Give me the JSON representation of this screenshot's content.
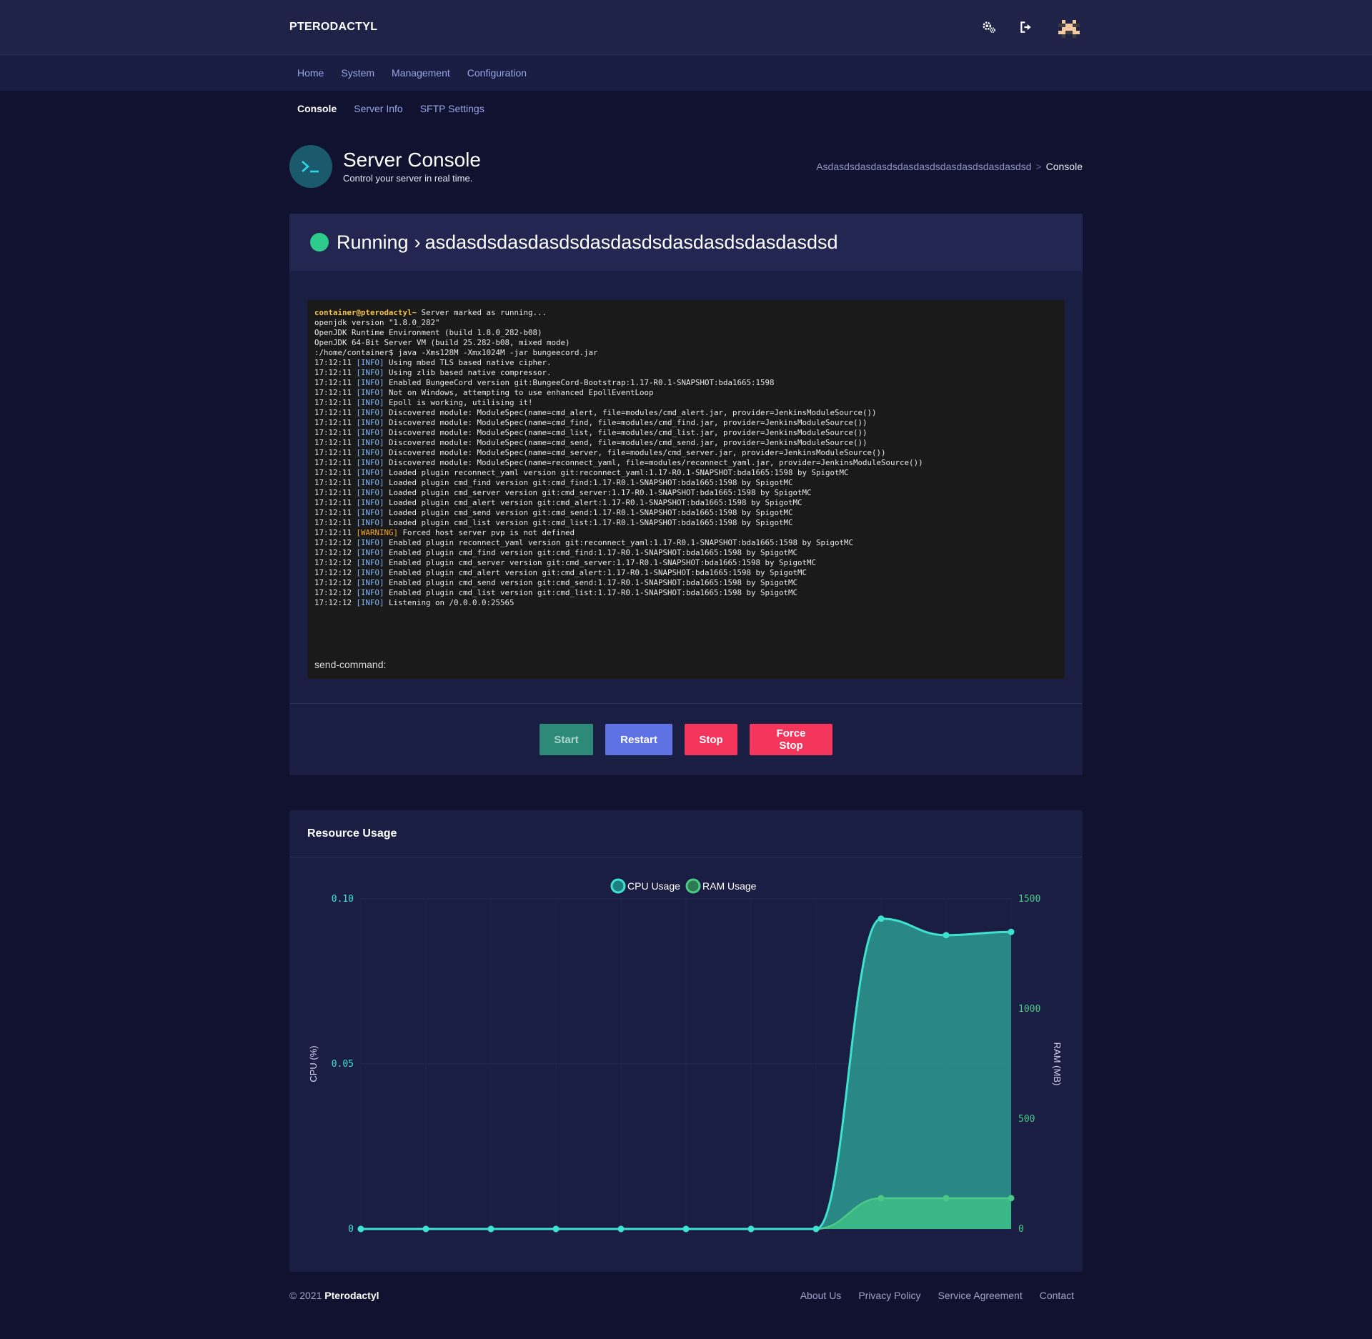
{
  "brand": "PTERODACTYL",
  "top_icons": [
    "settings-icon",
    "logout-icon",
    "avatar"
  ],
  "nav": [
    "Home",
    "System",
    "Management",
    "Configuration"
  ],
  "subnav": [
    "Console",
    "Server Info",
    "SFTP Settings"
  ],
  "header": {
    "title": "Server Console",
    "subtitle": "Control your server in real time.",
    "breadcrumb_parent": "Asdasdsdasdasdsdasdasdsdasdasdsdasdasdsd",
    "breadcrumb_sep": ">",
    "breadcrumb_current": "Console"
  },
  "server": {
    "status": "Running",
    "arrow": "›",
    "name": "asdasdsdasdasdsdasdasdsdasdasdsdasdasdsd"
  },
  "console": {
    "lines": [
      {
        "prompt": "container@pterodactyl~",
        "text": " Server marked as running..."
      },
      {
        "text": "openjdk version \"1.8.0_282\""
      },
      {
        "text": "OpenJDK Runtime Environment (build 1.8.0_282-b08)"
      },
      {
        "text": "OpenJDK 64-Bit Server VM (build 25.282-b08, mixed mode)"
      },
      {
        "text": ":/home/container$ java -Xms128M -Xmx1024M -jar bungeecord.jar"
      },
      {
        "time": "17:12:11",
        "level": "INFO",
        "text": " Using mbed TLS based native cipher."
      },
      {
        "time": "17:12:11",
        "level": "INFO",
        "text": " Using zlib based native compressor."
      },
      {
        "time": "17:12:11",
        "level": "INFO",
        "text": " Enabled BungeeCord version git:BungeeCord-Bootstrap:1.17-R0.1-SNAPSHOT:bda1665:1598"
      },
      {
        "time": "17:12:11",
        "level": "INFO",
        "text": " Not on Windows, attempting to use enhanced EpollEventLoop"
      },
      {
        "time": "17:12:11",
        "level": "INFO",
        "text": " Epoll is working, utilising it!"
      },
      {
        "time": "17:12:11",
        "level": "INFO",
        "text": " Discovered module: ModuleSpec(name=cmd_alert, file=modules/cmd_alert.jar, provider=JenkinsModuleSource())"
      },
      {
        "time": "17:12:11",
        "level": "INFO",
        "text": " Discovered module: ModuleSpec(name=cmd_find, file=modules/cmd_find.jar, provider=JenkinsModuleSource())"
      },
      {
        "time": "17:12:11",
        "level": "INFO",
        "text": " Discovered module: ModuleSpec(name=cmd_list, file=modules/cmd_list.jar, provider=JenkinsModuleSource())"
      },
      {
        "time": "17:12:11",
        "level": "INFO",
        "text": " Discovered module: ModuleSpec(name=cmd_send, file=modules/cmd_send.jar, provider=JenkinsModuleSource())"
      },
      {
        "time": "17:12:11",
        "level": "INFO",
        "text": " Discovered module: ModuleSpec(name=cmd_server, file=modules/cmd_server.jar, provider=JenkinsModuleSource())"
      },
      {
        "time": "17:12:11",
        "level": "INFO",
        "text": " Discovered module: ModuleSpec(name=reconnect_yaml, file=modules/reconnect_yaml.jar, provider=JenkinsModuleSource())"
      },
      {
        "time": "17:12:11",
        "level": "INFO",
        "text": " Loaded plugin reconnect_yaml version git:reconnect_yaml:1.17-R0.1-SNAPSHOT:bda1665:1598 by SpigotMC"
      },
      {
        "time": "17:12:11",
        "level": "INFO",
        "text": " Loaded plugin cmd_find version git:cmd_find:1.17-R0.1-SNAPSHOT:bda1665:1598 by SpigotMC"
      },
      {
        "time": "17:12:11",
        "level": "INFO",
        "text": " Loaded plugin cmd_server version git:cmd_server:1.17-R0.1-SNAPSHOT:bda1665:1598 by SpigotMC"
      },
      {
        "time": "17:12:11",
        "level": "INFO",
        "text": " Loaded plugin cmd_alert version git:cmd_alert:1.17-R0.1-SNAPSHOT:bda1665:1598 by SpigotMC"
      },
      {
        "time": "17:12:11",
        "level": "INFO",
        "text": " Loaded plugin cmd_send version git:cmd_send:1.17-R0.1-SNAPSHOT:bda1665:1598 by SpigotMC"
      },
      {
        "time": "17:12:11",
        "level": "INFO",
        "text": " Loaded plugin cmd_list version git:cmd_list:1.17-R0.1-SNAPSHOT:bda1665:1598 by SpigotMC"
      },
      {
        "time": "17:12:11",
        "level": "WARNING",
        "text": " Forced host server pvp is not defined"
      },
      {
        "time": "17:12:12",
        "level": "INFO",
        "text": " Enabled plugin reconnect_yaml version git:reconnect_yaml:1.17-R0.1-SNAPSHOT:bda1665:1598 by SpigotMC"
      },
      {
        "time": "17:12:12",
        "level": "INFO",
        "text": " Enabled plugin cmd_find version git:cmd_find:1.17-R0.1-SNAPSHOT:bda1665:1598 by SpigotMC"
      },
      {
        "time": "17:12:12",
        "level": "INFO",
        "text": " Enabled plugin cmd_server version git:cmd_server:1.17-R0.1-SNAPSHOT:bda1665:1598 by SpigotMC"
      },
      {
        "time": "17:12:12",
        "level": "INFO",
        "text": " Enabled plugin cmd_alert version git:cmd_alert:1.17-R0.1-SNAPSHOT:bda1665:1598 by SpigotMC"
      },
      {
        "time": "17:12:12",
        "level": "INFO",
        "text": " Enabled plugin cmd_send version git:cmd_send:1.17-R0.1-SNAPSHOT:bda1665:1598 by SpigotMC"
      },
      {
        "time": "17:12:12",
        "level": "INFO",
        "text": " Enabled plugin cmd_list version git:cmd_list:1.17-R0.1-SNAPSHOT:bda1665:1598 by SpigotMC"
      },
      {
        "time": "17:12:12",
        "level": "INFO",
        "text": " Listening on /0.0.0.0:25565"
      }
    ],
    "send_command_label": "send-command:"
  },
  "buttons": {
    "start": "Start",
    "restart": "Restart",
    "stop": "Stop",
    "force_stop": "Force Stop"
  },
  "colors": {
    "start": "#2d8a76",
    "restart": "#5e72e4",
    "stop": "#f5365c",
    "status_running": "#2ecc8c",
    "cpu": "#3ee3d0",
    "ram": "#4cc987"
  },
  "resource_title": "Resource Usage",
  "chart_data": {
    "type": "area",
    "title": "",
    "legend_position": "top-center",
    "y_left_label": "CPU (%)",
    "y_right_label": "RAM (MB)",
    "y_left_range": [
      0,
      0.1
    ],
    "y_right_range": [
      0,
      1500
    ],
    "y_left_ticks": [
      "0.10",
      "0.05",
      "0"
    ],
    "y_right_ticks": [
      "1500",
      "1000",
      "500",
      "0"
    ],
    "x_points": 11,
    "series": [
      {
        "name": "CPU Usage",
        "axis": "left",
        "values": [
          0,
          0,
          0,
          0,
          0,
          0,
          0,
          0,
          0.094,
          0.089,
          0.09
        ]
      },
      {
        "name": "RAM Usage",
        "axis": "right",
        "values": [
          0,
          0,
          0,
          0,
          0,
          0,
          0,
          0,
          140,
          140,
          140
        ]
      }
    ],
    "grid": true
  },
  "footer": {
    "copyright_prefix": "© 2021",
    "copyright_name": "Pterodactyl",
    "links": [
      "About Us",
      "Privacy Policy",
      "Service Agreement",
      "Contact"
    ]
  }
}
